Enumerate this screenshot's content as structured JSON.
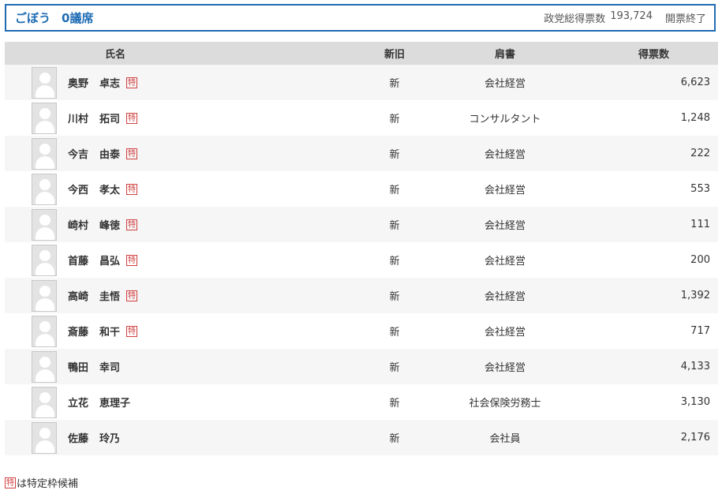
{
  "party": {
    "name": "ごぼう",
    "seats": "0議席",
    "votes_label": "政党総得票数",
    "votes_value": "193,724",
    "status": "開票終了"
  },
  "table": {
    "headers": {
      "name": "氏名",
      "status": "新旧",
      "title": "肩書",
      "votes": "得票数"
    },
    "badge_label": "特",
    "rows": [
      {
        "surname": "奥野",
        "given": "卓志",
        "badge": true,
        "status": "新",
        "title": "会社経営",
        "votes": "6,623"
      },
      {
        "surname": "川村",
        "given": "拓司",
        "badge": true,
        "status": "新",
        "title": "コンサルタント",
        "votes": "1,248"
      },
      {
        "surname": "今吉",
        "given": "由泰",
        "badge": true,
        "status": "新",
        "title": "会社経営",
        "votes": "222"
      },
      {
        "surname": "今西",
        "given": "孝太",
        "badge": true,
        "status": "新",
        "title": "会社経営",
        "votes": "553"
      },
      {
        "surname": "崎村",
        "given": "峰徳",
        "badge": true,
        "status": "新",
        "title": "会社経営",
        "votes": "111"
      },
      {
        "surname": "首藤",
        "given": "昌弘",
        "badge": true,
        "status": "新",
        "title": "会社経営",
        "votes": "200"
      },
      {
        "surname": "高崎",
        "given": "圭悟",
        "badge": true,
        "status": "新",
        "title": "会社経営",
        "votes": "1,392"
      },
      {
        "surname": "斎藤",
        "given": "和干",
        "badge": true,
        "status": "新",
        "title": "会社経営",
        "votes": "717"
      },
      {
        "surname": "鴨田",
        "given": "幸司",
        "badge": false,
        "status": "新",
        "title": "会社経営",
        "votes": "4,133"
      },
      {
        "surname": "立花",
        "given": "恵理子",
        "badge": false,
        "status": "新",
        "title": "社会保険労務士",
        "votes": "3,130"
      },
      {
        "surname": "佐藤",
        "given": "玲乃",
        "badge": false,
        "status": "新",
        "title": "会社員",
        "votes": "2,176"
      }
    ]
  },
  "footnote": {
    "badge_label": "特",
    "text": "は特定枠候補"
  },
  "icons": {
    "avatar": "person-silhouette-icon"
  }
}
